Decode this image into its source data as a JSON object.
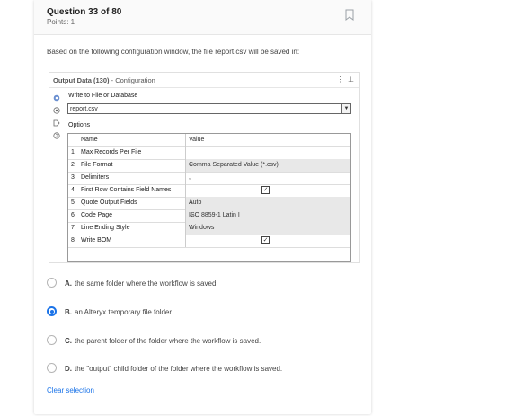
{
  "question": {
    "title": "Question 33 of 80",
    "points": "Points: 1",
    "text": "Based on the following configuration window, the file report.csv will be saved in:"
  },
  "config": {
    "tool_title": "Output Data (130)",
    "tool_subtitle": "- Configuration",
    "write_label": "Write to File or Database",
    "file_value": "report.csv",
    "options_label": "Options",
    "col_name": "Name",
    "col_value": "Value",
    "rows": [
      {
        "num": "1",
        "name": "Max Records Per File",
        "value": "",
        "kind": "text"
      },
      {
        "num": "2",
        "name": "File Format",
        "value": "Comma Separated Value (*.csv)",
        "kind": "dropdown"
      },
      {
        "num": "3",
        "name": "Delimiters",
        "value": ",",
        "kind": "text"
      },
      {
        "num": "4",
        "name": "First Row Contains Field Names",
        "value": "",
        "kind": "checkbox"
      },
      {
        "num": "5",
        "name": "Quote Output Fields",
        "value": "Auto",
        "kind": "dropdown"
      },
      {
        "num": "6",
        "name": "Code Page",
        "value": "ISO 8859-1 Latin I",
        "kind": "dropdown"
      },
      {
        "num": "7",
        "name": "Line Ending Style",
        "value": "Windows",
        "kind": "dropdown"
      },
      {
        "num": "8",
        "name": "Write BOM",
        "value": "",
        "kind": "checkbox"
      }
    ]
  },
  "answers": [
    {
      "letter": "A.",
      "text": "the same folder where the workflow is saved.",
      "selected": false
    },
    {
      "letter": "B.",
      "text": "an Alteryx temporary file folder.",
      "selected": true
    },
    {
      "letter": "C.",
      "text": "the parent folder of the folder where the workflow is saved.",
      "selected": false
    },
    {
      "letter": "D.",
      "text": "the \"output\" child folder of the folder where the workflow is saved.",
      "selected": false
    }
  ],
  "clear_label": "Clear selection",
  "colors": {
    "accent": "#1a73e8"
  }
}
